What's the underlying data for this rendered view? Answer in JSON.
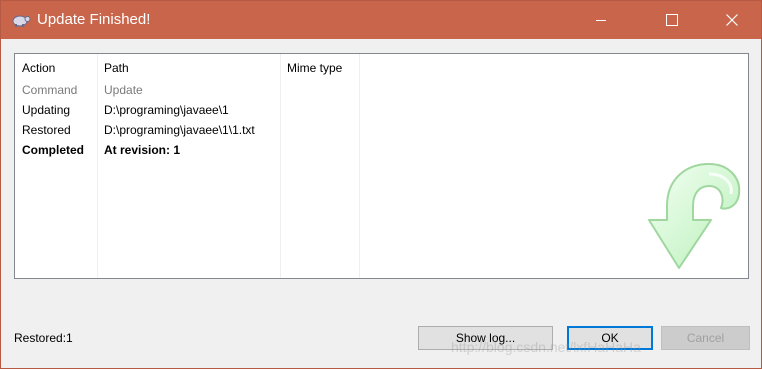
{
  "window": {
    "title": "Update Finished!"
  },
  "table": {
    "columns": [
      "Action",
      "Path",
      "Mime type"
    ],
    "rows": [
      {
        "action": "Command",
        "path": "Update",
        "style": "gray"
      },
      {
        "action": "Updating",
        "path": "D:\\programing\\javaee\\1",
        "style": "normal"
      },
      {
        "action": "Restored",
        "path": "D:\\programing\\javaee\\1\\1.txt",
        "style": "normal"
      },
      {
        "action": "Completed",
        "path": "At revision: 1",
        "style": "bold"
      }
    ]
  },
  "status": "Restored:1",
  "buttons": {
    "show_log": "Show log...",
    "ok": "OK",
    "cancel": "Cancel"
  },
  "watermark": "http://blog.csdn.net/lxfHaHaHa",
  "colors": {
    "titlebar": "#c8654b",
    "accent": "#0078d7"
  },
  "icons": [
    "tortoise-icon",
    "minimize-icon",
    "maximize-icon",
    "close-icon",
    "update-arrow-icon"
  ]
}
